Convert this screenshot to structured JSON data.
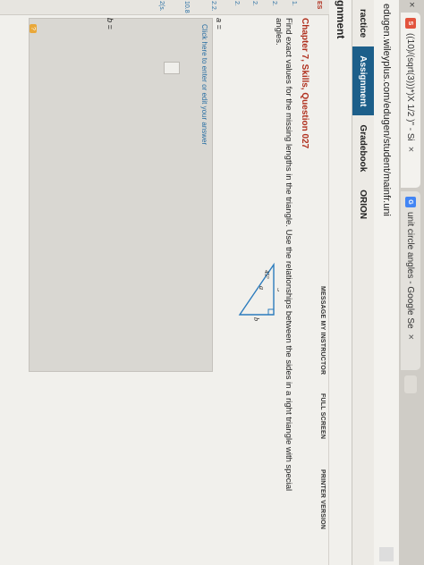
{
  "browser": {
    "tabs": [
      {
        "title": "((10)/(sqrt(3)))*)X 1/2 )\" - Si",
        "favicon": "S",
        "favicon_color": "#e2543e"
      },
      {
        "title": "unit circle angles - Google Se",
        "favicon": "G",
        "favicon_color": "#4285f4"
      }
    ],
    "close_label": "×",
    "url": "edugen.wileyplus.com/edugen/student/mainfr.uni"
  },
  "nav": {
    "items": [
      "ractice",
      "Assignment",
      "Gradebook",
      "ORION"
    ],
    "active_index": 1
  },
  "assignment_header": "gnment",
  "left_column": [
    "ES",
    "1.",
    "2.",
    "2.",
    "2.",
    "2.2.",
    "10.8",
    "2(s."
  ],
  "toolbar": {
    "message_instructor": "MESSAGE MY INSTRUCTOR",
    "full_screen": "FULL SCREEN",
    "printer_version": "PRINTER VERSION"
  },
  "question": {
    "title": "Chapter 7, Skills, Question 027",
    "text": "Find exact values for the missing lengths in the triangle. Use the relationships between the sides in a right triangle with special angles.",
    "triangle": {
      "side_a": "a",
      "side_b": "b",
      "angle": "45°",
      "base": "5"
    }
  },
  "answer": {
    "a_label": "a =",
    "b_label": "b =",
    "link": "Click here to enter or edit your answer",
    "help": "?"
  },
  "colors": {
    "accent": "#1d5f8a",
    "title_red": "#b0301e",
    "link_blue": "#2a6fa3",
    "triangle": "#2b7bbd"
  }
}
